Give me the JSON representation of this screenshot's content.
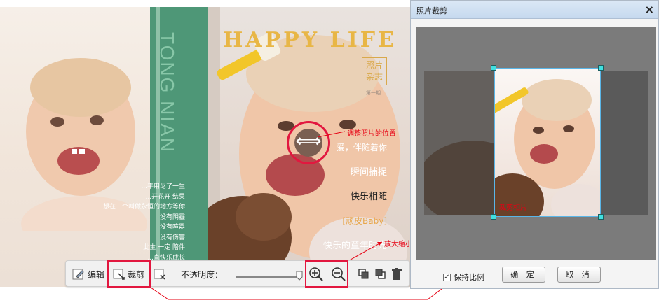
{
  "magazine": {
    "spine_title": "TONG NIAN",
    "cover_title": "HAPPY  LIFE",
    "seal_text": [
      "照片",
      "杂志"
    ],
    "issue_label": "第一期",
    "poem_lines": [
      "...平用尽了一生",
      "...开花开   结果",
      "想在一个叫做永恒的地方等你",
      "没有阴霾",
      "没有喧嚣",
      "没有伤害",
      "此生   一定   陪伴",
      "...直快乐成长"
    ],
    "cover_lines": [
      "爱，伴随着你",
      "瞬间捕捉",
      "快乐相随",
      "[顽皮Baby]",
      "快乐的童年时光"
    ],
    "move_glyph": "⟺"
  },
  "annotations": {
    "move_hint": "调整照片的位置",
    "zoom_hint": "放大缩小照片",
    "crop_hint": "裁剪相片"
  },
  "toolbar": {
    "edit_label": "编辑",
    "crop_label": "裁剪",
    "opacity_label": "不透明度：",
    "opacity_value": 0.98
  },
  "dialog": {
    "title": "照片裁剪",
    "close_glyph": "×",
    "keep_ratio_label": "保持比例",
    "keep_ratio_checked": true,
    "check_glyph": "✓",
    "ok_label": "确 定",
    "cancel_label": "取 消"
  },
  "colors": {
    "highlight": "#e2173f",
    "band_green": "#4e9777",
    "title_gold": "#e8b646",
    "handle_cyan": "#41e0e0"
  }
}
